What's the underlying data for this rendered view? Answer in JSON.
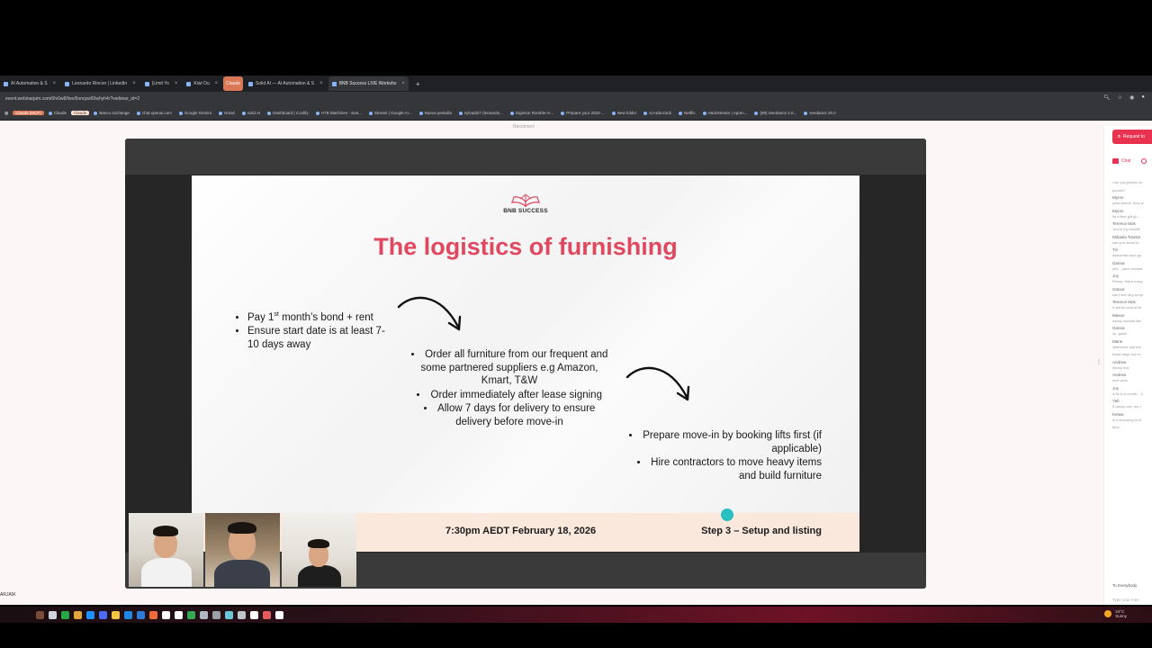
{
  "browser": {
    "tabs": [
      {
        "label": "AI Automation & S",
        "active": false,
        "claude": false
      },
      {
        "label": "Leonardo Rincon | LinkedIn",
        "active": false,
        "claude": false
      },
      {
        "label": "(Limit Yo",
        "active": false,
        "claude": false
      },
      {
        "label": "Kiwi Ou",
        "active": false,
        "claude": false
      },
      {
        "label": "Claude",
        "active": false,
        "claude": true
      },
      {
        "label": "Solid AI — AI Automation & S",
        "active": false,
        "claude": false
      },
      {
        "label": "BNB Success LIVE Worksho",
        "active": true,
        "claude": false
      }
    ],
    "url": "event.webinarjam.com/t0v0w8/live/6nncpw93whyh4r?webinar_id=2",
    "bookmarks": [
      {
        "label": "Claude (MCP)",
        "style": "pill"
      },
      {
        "label": "Claude",
        "style": "plain"
      },
      {
        "label": "Claude",
        "style": "pill2"
      },
      {
        "label": "Banco exchange",
        "style": "plain"
      },
      {
        "label": "chat.openai.com",
        "style": "plain"
      },
      {
        "label": "Google Gemini",
        "style": "plain"
      },
      {
        "label": "Gmail",
        "style": "plain"
      },
      {
        "label": "solid AI",
        "style": "plain"
      },
      {
        "label": "Dashboard | Coolify",
        "style": "plain"
      },
      {
        "label": "HTB Machines - Sea...",
        "style": "plain"
      },
      {
        "label": "Stream | Google AI...",
        "style": "plain"
      },
      {
        "label": "Nueva pestaña",
        "style": "plain"
      },
      {
        "label": "sylvadt27 (leonardo...",
        "style": "plain"
      },
      {
        "label": "Digimon Rumble Ar...",
        "style": "plain"
      },
      {
        "label": "Prepare your 2022-...",
        "style": "plain"
      },
      {
        "label": "New folder",
        "style": "plain"
      },
      {
        "label": "scAIda track",
        "style": "plain"
      },
      {
        "label": "Netflix",
        "style": "plain"
      },
      {
        "label": "HackStream | Apren...",
        "style": "plain"
      },
      {
        "label": "(89) Seedance 2.0...",
        "style": "plain"
      },
      {
        "label": "seedance 20.0",
        "style": "plain"
      }
    ]
  },
  "page": {
    "reconnect": "Reconnect",
    "footer_user": "ARJAM"
  },
  "slide": {
    "logo_text": "BNB SUCCESS",
    "title": "The logistics of furnishing",
    "col1": {
      "item1_pre": "Pay 1",
      "item1_sup": "st",
      "item1_post": " month’s bond + rent",
      "item2": "Ensure start date is at least 7-10 days away"
    },
    "col2": [
      "Order all furniture from our frequent and some partnered suppliers e.g Amazon, Kmart, T&W",
      "Order immediately after lease signing",
      "Allow 7 days for delivery to ensure delivery before move-in"
    ],
    "col3": [
      "Prepare move-in by booking lifts first (if applicable)",
      "Hire contractors to move heavy items and build furniture"
    ],
    "footer_date": "7:30pm AEDT February 18, 2026",
    "footer_step": "Step 3 – Setup and listing"
  },
  "chat": {
    "request_button": "Request to",
    "tab_label": "Chat",
    "messages": [
      {
        "name": "",
        "text": "Can you please sh"
      },
      {
        "name": "",
        "text": "prexes?"
      },
      {
        "name": "Myron",
        "text": "yeah mohol, they w"
      },
      {
        "name": "Myron",
        "text": "Its a free gift (ju..."
      },
      {
        "name": "Terence Mok",
        "text": "You're my emotiff"
      },
      {
        "name": "Mihaela Toloste",
        "text": "can you zoom in"
      },
      {
        "name": "Tin",
        "text": "awesome work gu"
      },
      {
        "name": "Ganna",
        "text": "yes... pace unclear"
      },
      {
        "name": "Joy",
        "text": "Penny: that's crazy"
      },
      {
        "name": "Ganna",
        "text": "can't see any script"
      },
      {
        "name": "Terence Mok",
        "text": "It will be sent af th"
      },
      {
        "name": "Mason",
        "text": "danny sounds like"
      },
      {
        "name": "Ganna",
        "text": "ok, great"
      },
      {
        "name": "Marie",
        "text": "@terence and tea"
      },
      {
        "name": "",
        "text": "these days due to"
      },
      {
        "name": "Andrew",
        "text": "danny boy"
      },
      {
        "name": "Andrew",
        "text": "nice work"
      },
      {
        "name": "Joy",
        "text": "4.5k in a month... n"
      },
      {
        "name": "Yah",
        "text": "If danny can, we c"
      },
      {
        "name": "Ketwa",
        "text": "Is it annoying to fit"
      },
      {
        "name": "",
        "text": "floor"
      }
    ],
    "to_label": "To Everybody",
    "type_placeholder": "Type your mes"
  },
  "taskbar": {
    "weather_temp": "24°C",
    "weather_label": "Sunny",
    "icon_colors": [
      "#7a4a3a",
      "#cfd4dc",
      "#27a745",
      "#e2a33a",
      "#1e90ff",
      "#4a6cf7",
      "#f4c542",
      "#1e88e5",
      "#2b7bd8",
      "#ef6c3a",
      "#ffffff",
      "#ffffff",
      "#34a853",
      "#b0b8c4",
      "#9aa0a6",
      "#6ac7d8",
      "#c0c6cc",
      "#ffffff",
      "#e35b5b",
      "#ffffff"
    ]
  }
}
